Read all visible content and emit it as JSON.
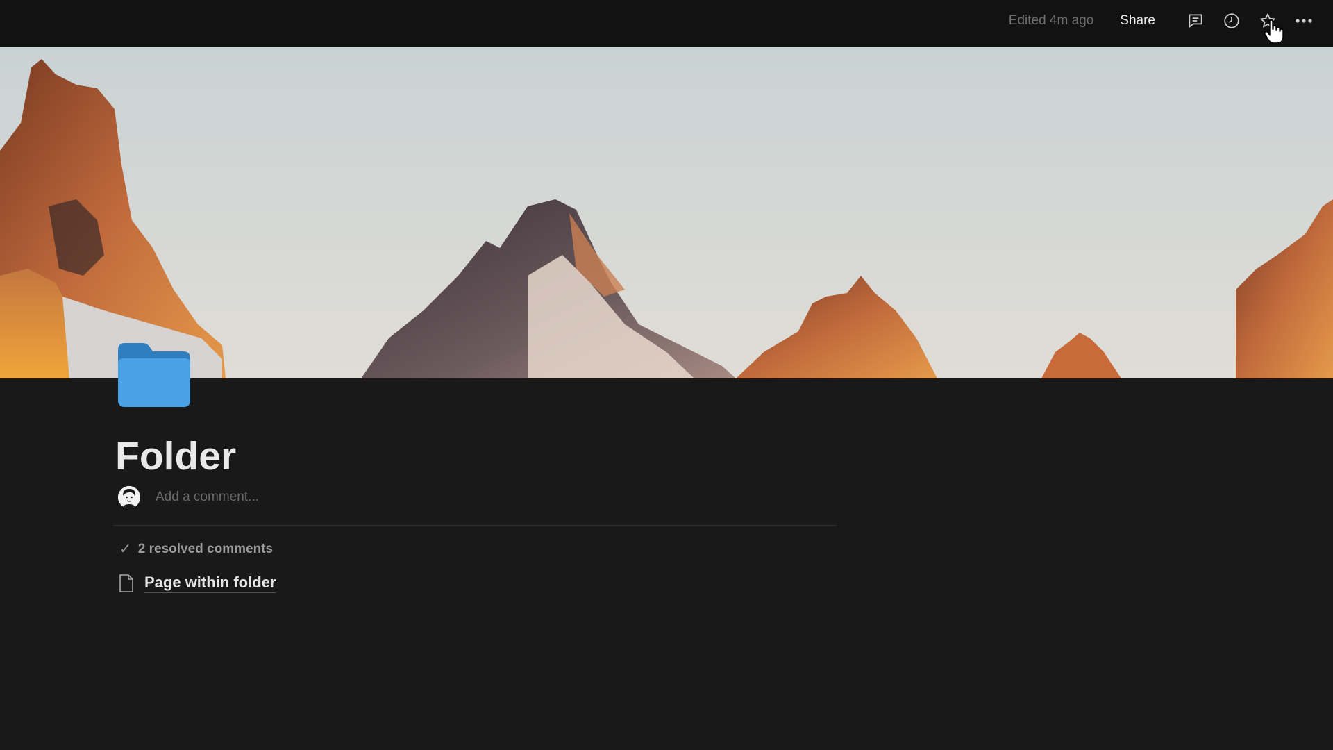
{
  "topbar": {
    "edited_text": "Edited 4m ago",
    "share_label": "Share",
    "icons": [
      "comment-icon",
      "history-icon",
      "star-icon",
      "more-icon"
    ]
  },
  "cover": {
    "image": "mountain-peaks-at-sunset"
  },
  "page": {
    "icon": "folder-icon",
    "icon_color": "#3b8ed0",
    "title": "Folder"
  },
  "comments": {
    "placeholder": "Add a comment...",
    "resolved_label": "2 resolved comments"
  },
  "content": {
    "subpages": [
      {
        "icon": "page-icon",
        "label": "Page within folder"
      }
    ]
  }
}
